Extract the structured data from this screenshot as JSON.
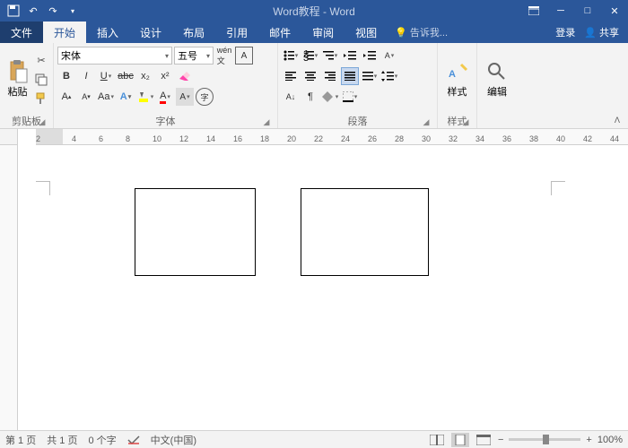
{
  "title": "Word教程 - Word",
  "tabs": {
    "file": "文件",
    "home": "开始",
    "insert": "插入",
    "design": "设计",
    "layout": "布局",
    "references": "引用",
    "mailings": "邮件",
    "review": "审阅",
    "view": "视图",
    "tellme": "告诉我..."
  },
  "account": {
    "login": "登录",
    "share": "共享"
  },
  "ribbon": {
    "clipboard": {
      "label": "剪贴板",
      "paste": "粘贴"
    },
    "font": {
      "label": "字体",
      "name": "宋体",
      "size": "五号"
    },
    "paragraph": {
      "label": "段落"
    },
    "styles": {
      "label": "样式",
      "btn": "样式"
    },
    "editing": {
      "label": "",
      "btn": "编辑"
    }
  },
  "ruler": {
    "marks": [
      2,
      4,
      6,
      8,
      10,
      12,
      14,
      16,
      18,
      20,
      22,
      24,
      26,
      28,
      30,
      32,
      34,
      36,
      38,
      40,
      42,
      44
    ]
  },
  "status": {
    "page": "第 1 页",
    "pages": "共 1 页",
    "words": "0 个字",
    "lang_icon": "",
    "lang": "中文(中国)",
    "zoom": "100%"
  }
}
